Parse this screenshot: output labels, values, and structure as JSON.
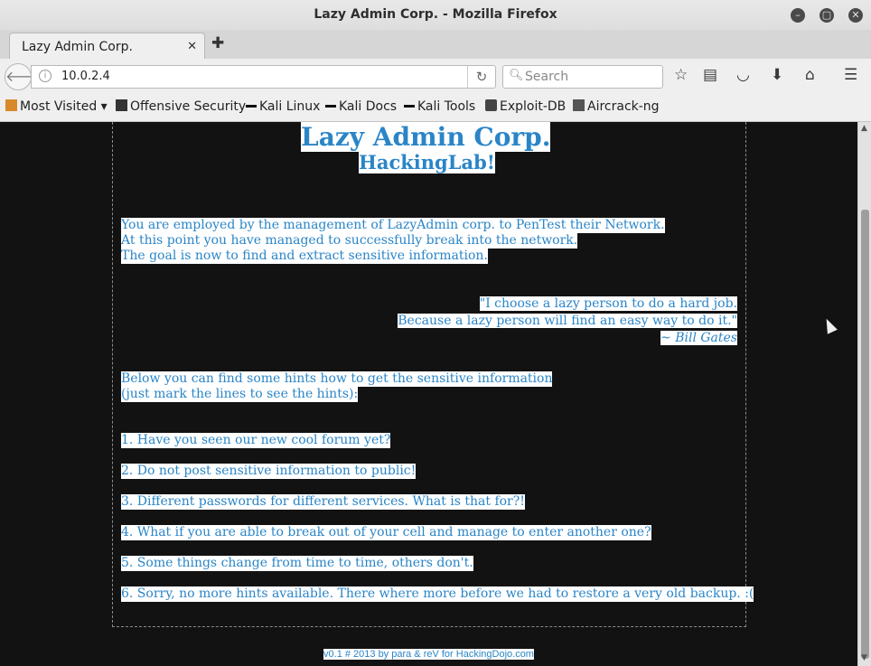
{
  "window": {
    "title": "Lazy Admin Corp. - Mozilla Firefox"
  },
  "tab": {
    "label": "Lazy Admin Corp."
  },
  "nav": {
    "url": "10.0.2.4",
    "search_placeholder": "Search"
  },
  "bookmarks": [
    "Most Visited ▾",
    "Offensive Security",
    "Kali Linux",
    "Kali Docs",
    "Kali Tools",
    "Exploit-DB",
    "Aircrack-ng"
  ],
  "page": {
    "title": "Lazy Admin Corp.",
    "subtitle": "HackingLab!",
    "intro": [
      "You are employed by the management of LazyAdmin corp. to PenTest their Network.",
      "At this point you have managed to successfully break into the network.",
      "The goal is now to find and extract sensitive information."
    ],
    "quote": [
      "\"I choose a lazy person to do a hard job.",
      "Because a lazy person will find an easy way to do it.\"",
      "~ Bill Gates"
    ],
    "hints_intro": [
      "Below you can find some hints how to get the sensitive information",
      "(just mark the lines to see the hints):"
    ],
    "hints": [
      "1. Have you seen our new cool forum yet?",
      "2. Do not post sensitive information to public!",
      "3. Different passwords for different services. What is that for?!",
      "4. What if you are able to break out of your cell and manage to enter another one?",
      "5. Some things change from time to time, others don't.",
      "6. Sorry, no more hints available. There where more before we had to restore a very old backup. :("
    ],
    "footer": "v0.1 # 2013 by para & reV for HackingDojo.com"
  }
}
